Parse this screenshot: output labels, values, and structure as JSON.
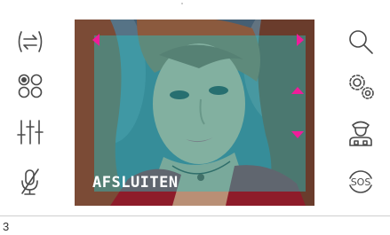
{
  "screen": {
    "exit_label": "AFSLUITEN",
    "page_number": "3",
    "overlay_color": "#21cdd0",
    "arrow_color": "#f01c9a"
  },
  "left_toolbar": [
    {
      "icon": "swap-arrows-icon",
      "name": "switch-camera-button"
    },
    {
      "icon": "four-circles-icon",
      "name": "camera-select-button"
    },
    {
      "icon": "sliders-icon",
      "name": "adjust-button"
    },
    {
      "icon": "microphone-off-icon",
      "name": "mute-microphone-button"
    }
  ],
  "right_toolbar": [
    {
      "icon": "search-icon",
      "name": "zoom-button"
    },
    {
      "icon": "gears-icon",
      "name": "settings-button"
    },
    {
      "icon": "concierge-icon",
      "name": "concierge-button"
    },
    {
      "icon": "sos-icon",
      "name": "sos-button",
      "label": "SOS"
    }
  ]
}
